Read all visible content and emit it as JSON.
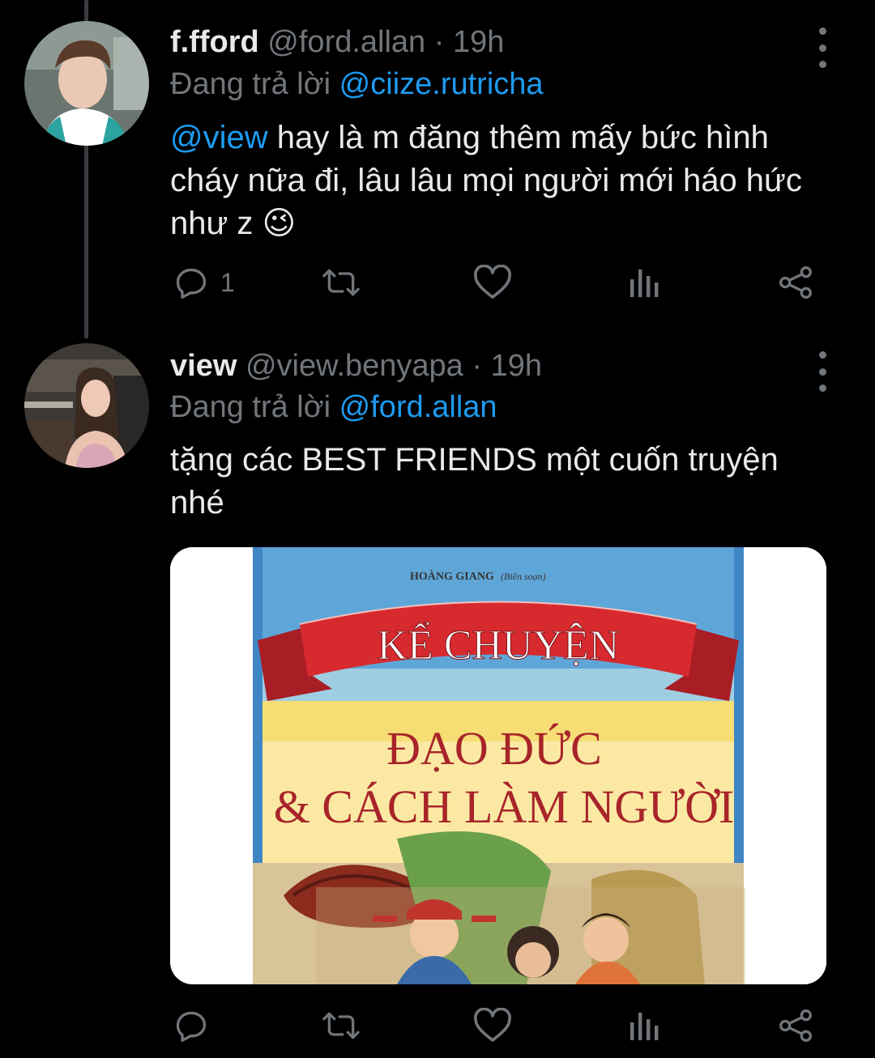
{
  "tweets": [
    {
      "name": "f.fford",
      "handle": "@ford.allan",
      "separator": "·",
      "time": "19h",
      "reply_prefix": "Đang trả lời",
      "reply_to": "@ciize.rutricha",
      "mention": "@view",
      "text": " hay là m đăng thêm mấy bức hình cháy nữa đi, lâu lâu mọi người mới háo hức như z ",
      "emoji": "😉",
      "reply_count": "1",
      "icons": [
        "reply-icon",
        "retweet-icon",
        "like-icon",
        "analytics-icon",
        "share-icon"
      ]
    },
    {
      "name": "view",
      "handle": "@view.benyapa",
      "separator": "·",
      "time": "19h",
      "reply_prefix": "Đang trả lời",
      "reply_to": "@ford.allan",
      "text": "tặng các BEST FRIENDS một cuốn truyện nhé",
      "reply_count": "",
      "icons": [
        "reply-icon",
        "retweet-icon",
        "like-icon",
        "analytics-icon",
        "share-icon"
      ],
      "media": {
        "author": "HOÀNG GIANG",
        "author_role": "(Biên soạn)",
        "banner": "KỂ CHUYỆN",
        "title_line1": "ĐẠO ĐỨC",
        "title_line2": "& CÁCH LÀM NGƯỜI"
      }
    }
  ],
  "colors": {
    "background": "#000000",
    "text": "#e7e9ea",
    "muted": "#71767b",
    "link": "#1d9bf0",
    "thread_line": "#3a3d41"
  }
}
